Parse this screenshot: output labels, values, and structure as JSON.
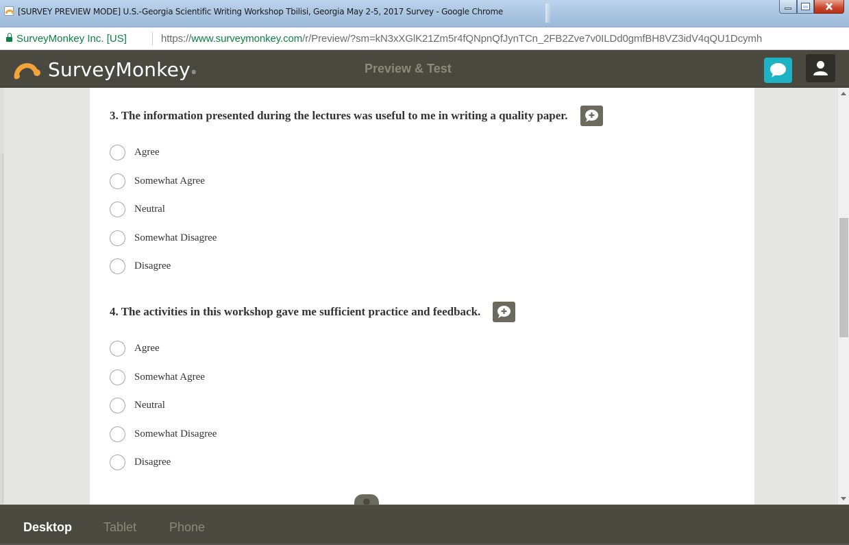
{
  "browser": {
    "window_title": "[SURVEY PREVIEW MODE] U.S.-Georgia Scientific Writing Workshop Tbilisi, Georgia May 2-5, 2017 Survey - Google Chrome",
    "site_identity": "SurveyMonkey Inc. [US]",
    "url_scheme": "https://",
    "url_host": "www.surveymonkey.com",
    "url_path": "/r/Preview/?sm=kN3xXGlK21Zm5r4fQNpnQfJynTCn_2FB2Zve7v0ILDd0gmfBH8VZ3idV4qQU1Dcymh"
  },
  "header": {
    "logo_text": "SurveyMonkey",
    "logo_mark": "®",
    "center_title": "Preview & Test",
    "chat_icon": "chat-bubble-icon",
    "user_icon": "user-icon",
    "accent_color": "#1eb2c5",
    "bar_color": "#4a4940"
  },
  "questions": [
    {
      "title": "3. The information presented during the lectures was useful to me in writing a quality paper.",
      "options": [
        "Agree",
        "Somewhat Agree",
        "Neutral",
        "Somewhat Disagree",
        "Disagree"
      ]
    },
    {
      "title": "4. The activities in this workshop gave me sufficient practice and feedback.",
      "options": [
        "Agree",
        "Somewhat Agree",
        "Neutral",
        "Somewhat Disagree",
        "Disagree"
      ]
    }
  ],
  "device_tabs": {
    "selected": "Desktop",
    "items": [
      "Desktop",
      "Tablet",
      "Phone"
    ]
  }
}
